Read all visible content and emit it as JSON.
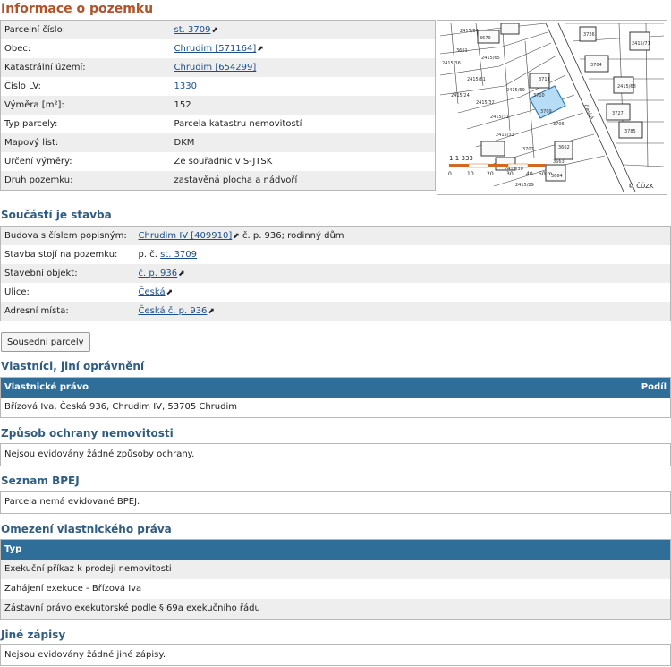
{
  "title": "Informace o pozemku",
  "parcel": {
    "rows": [
      {
        "label": "Parcelní číslo:",
        "value": "st. 3709",
        "link": true,
        "ext": true
      },
      {
        "label": "Obec:",
        "value": "Chrudim [571164]",
        "link": true,
        "ext": true
      },
      {
        "label": "Katastrální území:",
        "value": "Chrudim [654299]",
        "link": true,
        "ext": false
      },
      {
        "label": "Číslo LV:",
        "value": "1330",
        "link": true,
        "ext": false
      },
      {
        "label": "Výměra [m²]:",
        "value": "152",
        "link": false,
        "ext": false
      },
      {
        "label": "Typ parcely:",
        "value": "Parcela katastru nemovitostí",
        "link": false,
        "ext": false
      },
      {
        "label": "Mapový list:",
        "value": "DKM",
        "link": false,
        "ext": false
      },
      {
        "label": "Určení výměry:",
        "value": "Ze souřadnic v S-JTSK",
        "link": false,
        "ext": false
      },
      {
        "label": "Druh pozemku:",
        "value": "zastavěná plocha a nádvoří",
        "link": false,
        "ext": false
      }
    ]
  },
  "map": {
    "scale_label": "1:1 333",
    "scale_ticks": [
      "0",
      "10",
      "20",
      "30",
      "40",
      "50 m"
    ],
    "copyright": "© ČÚZK",
    "parcel_labels": [
      "2415/64",
      "3679",
      "3661",
      "2415/65",
      "3726",
      "3704",
      "2415/71",
      "2415/36",
      "2415/61",
      "2415/24",
      "2415/32",
      "2415/69",
      "3711",
      "3710",
      "3709",
      "3706",
      "2415/31",
      "2415/33",
      "3707",
      "2415/30",
      "2415/29",
      "3662",
      "3663",
      "3664",
      "2415/68",
      "2415/70",
      "3727",
      "3785",
      "Česká"
    ]
  },
  "stavba": {
    "title": "Součástí je stavba",
    "budova_label": "Budova s číslem popisným:",
    "budova_link": "Chrudim IV [409910]",
    "budova_text": " č. p. 936; rodinný dům",
    "stoji_label": "Stavba stojí na pozemku:",
    "stoji_prefix": "p. č.",
    "stoji_link": "st. 3709",
    "objekt_label": "Stavební objekt:",
    "objekt_link": "č. p. 936",
    "ulice_label": "Ulice:",
    "ulice_link": "Česká",
    "adresni_label": "Adresní místa:",
    "adresni_link": "Česká č. p. 936"
  },
  "button_label": "Sousední parcely",
  "vlastnici": {
    "title": "Vlastníci, jiní oprávnění",
    "header_left": "Vlastnické právo",
    "header_right": "Podíl",
    "owner": "Břízová Iva, Česká 936, Chrudim IV, 53705 Chrudim"
  },
  "ochrana": {
    "title": "Způsob ochrany nemovitosti",
    "text": "Nejsou evidovány žádné způsoby ochrany."
  },
  "bpej": {
    "title": "Seznam BPEJ",
    "text": "Parcela nemá evidované BPEJ."
  },
  "omezeni": {
    "title": "Omezení vlastnického práva",
    "header": "Typ",
    "items": [
      "Exekuční příkaz k prodeji nemovitosti",
      "Zahájení exekuce - Břízová Iva",
      "Zástavní právo exekutorské podle § 69a exekučního řádu"
    ]
  },
  "jine": {
    "title": "Jiné zápisy",
    "text": "Nejsou evidovány žádné jiné zápisy."
  }
}
